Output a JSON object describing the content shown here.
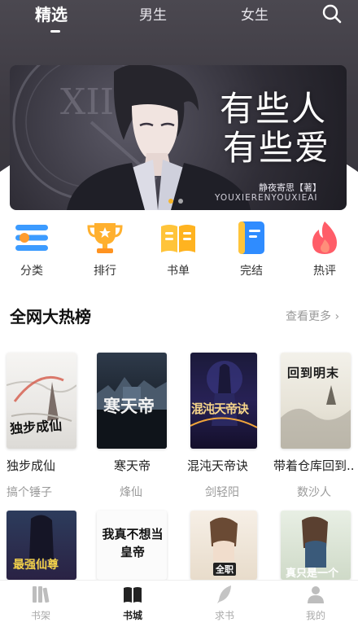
{
  "top_tabs": [
    {
      "label": "精选",
      "active": true
    },
    {
      "label": "男生",
      "active": false
    },
    {
      "label": "女生",
      "active": false
    }
  ],
  "banner": {
    "title_line1": "有些人",
    "title_line2": "有些爱",
    "author": "静夜寄思【著】",
    "pinyin": "YOUXIERENYOUXIEAI",
    "current_slide": 1,
    "slide_count": 2
  },
  "categories": [
    {
      "label": "分类",
      "icon": "list-icon",
      "color": "#3c9bff"
    },
    {
      "label": "排行",
      "icon": "trophy-icon",
      "color": "#ffb02e"
    },
    {
      "label": "书单",
      "icon": "open-book-icon",
      "color": "#ffc43a"
    },
    {
      "label": "完结",
      "icon": "notebook-icon",
      "color": "#2f8cff"
    },
    {
      "label": "热评",
      "icon": "flame-icon",
      "color": "#ff5d68"
    }
  ],
  "section": {
    "title": "全网大热榜",
    "more": "查看更多 ›"
  },
  "books": [
    {
      "title": "独步成仙",
      "author": "搞个锤子",
      "cover_text": "独步成仙"
    },
    {
      "title": "寒天帝",
      "author": "烽仙",
      "cover_text": "寒天帝"
    },
    {
      "title": "混沌天帝诀",
      "author": "剑轻阳",
      "cover_text": "混沌天帝诀"
    },
    {
      "title": "带着仓库回到...",
      "author": "数沙人",
      "cover_text": "回到明末"
    }
  ],
  "books_row2": [
    {
      "cover_text": "最强仙尊"
    },
    {
      "cover_text": "我真不想当皇帝"
    },
    {
      "cover_text": "全职"
    },
    {
      "cover_text": "真只是一个"
    }
  ],
  "bottom_nav": [
    {
      "label": "书架",
      "icon": "bookshelf-icon",
      "active": false
    },
    {
      "label": "书城",
      "icon": "book-city-icon",
      "active": true
    },
    {
      "label": "求书",
      "icon": "feather-icon",
      "active": false
    },
    {
      "label": "我的",
      "icon": "profile-icon",
      "active": false
    }
  ],
  "colors": {
    "header_bg": "#3d3a42",
    "accent_dot": "#f5b52a",
    "text_primary": "#222222",
    "text_secondary": "#9a9a9a"
  }
}
